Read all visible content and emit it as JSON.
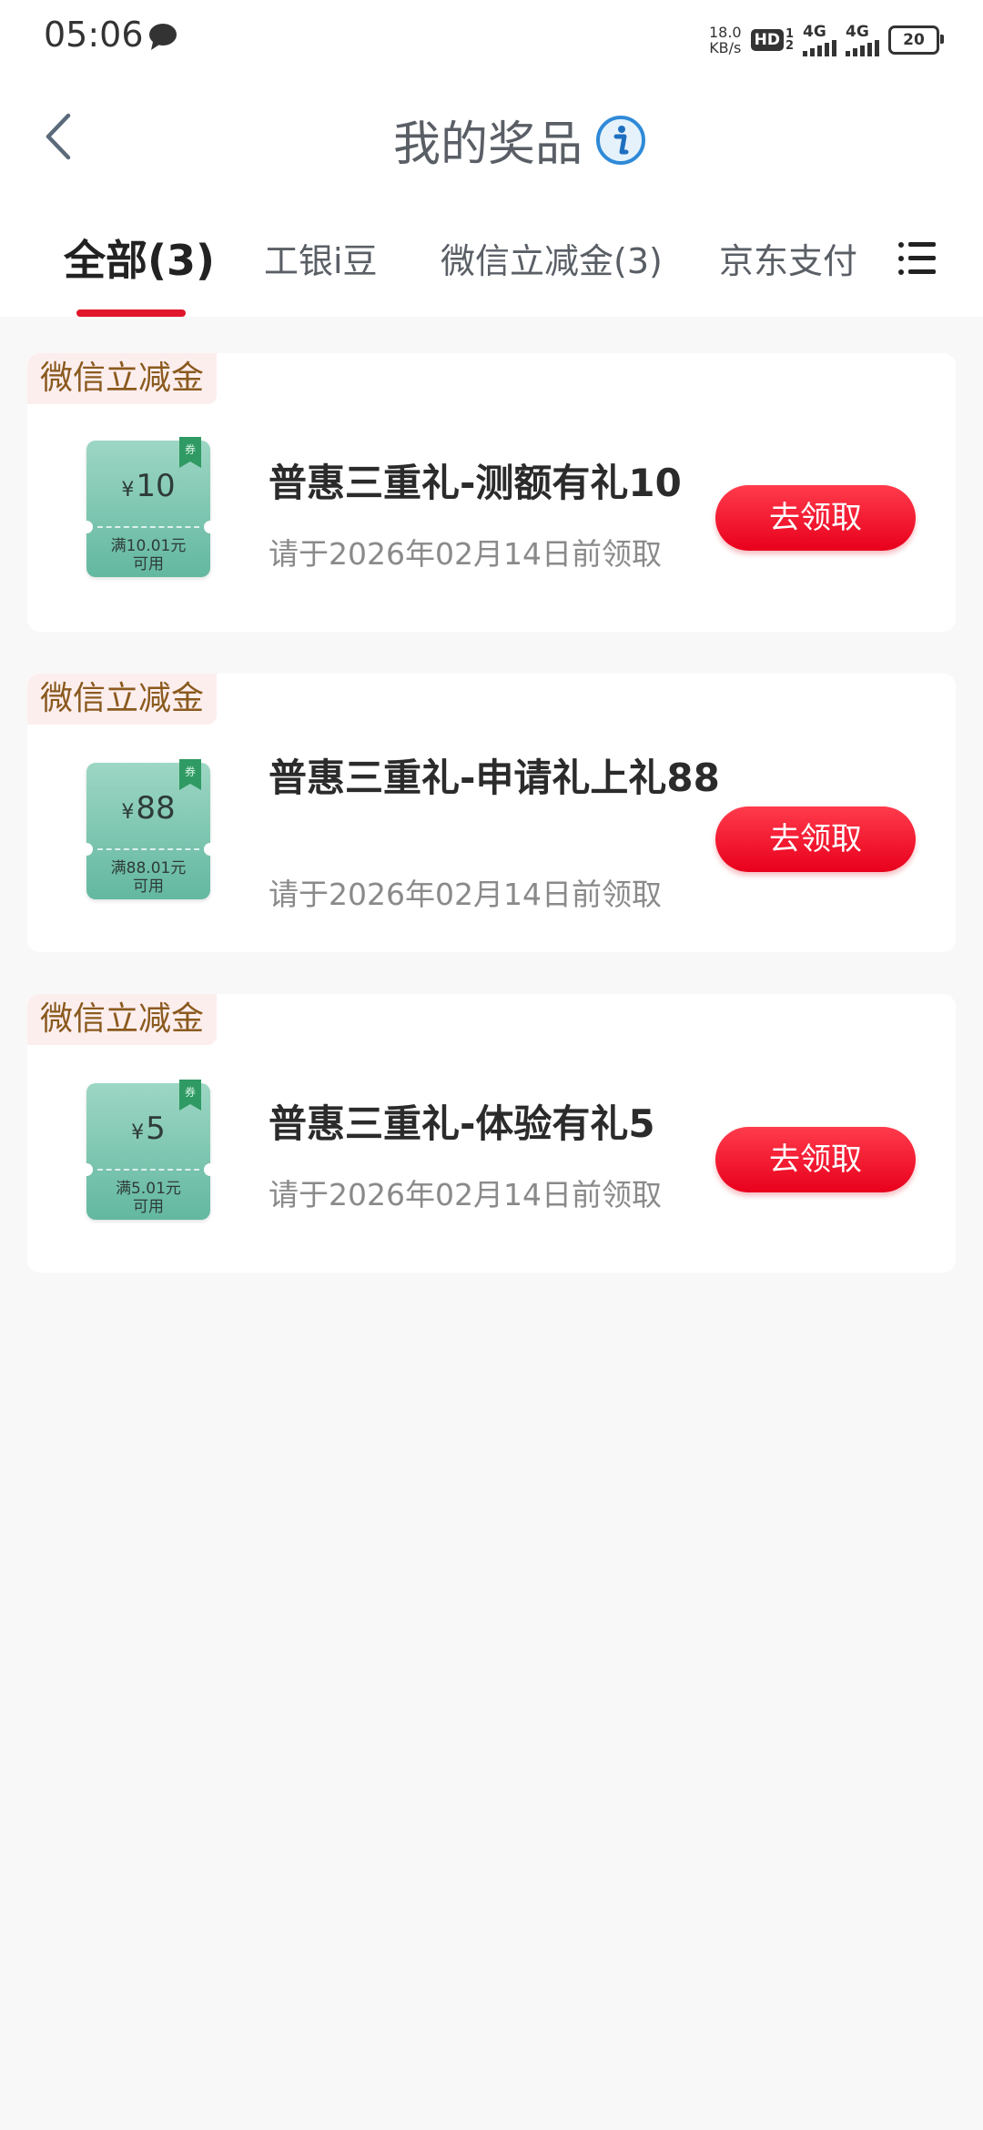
{
  "status_bar": {
    "time": "05:06",
    "net_speed_value": "18.0",
    "net_speed_unit": "KB/s",
    "hd_label": "HD",
    "hd_sub_1": "1",
    "hd_sub_2": "2",
    "signal1_label": "4G",
    "signal2_label": "4G",
    "battery_level": "20"
  },
  "header": {
    "title": "我的奖品"
  },
  "tabs": [
    {
      "label": "全部(3)",
      "active": true
    },
    {
      "label": "工银i豆",
      "active": false
    },
    {
      "label": "微信立减金(3)",
      "active": false
    },
    {
      "label": "京东支付",
      "active": false
    }
  ],
  "colors": {
    "accent": "#e1172c",
    "button": "#e8001c",
    "coupon": "#63b8a0",
    "tag_bg": "#fdeeee",
    "tag_text": "#8a5a1e"
  },
  "prizes": [
    {
      "tag": "微信立减金",
      "coupon_symbol": "¥",
      "coupon_amount": "10",
      "coupon_condition_1": "满10.01元",
      "coupon_condition_2": "可用",
      "name": "普惠三重礼-测额有礼10",
      "deadline": "请于2026年02月14日前领取",
      "button_label": "去领取"
    },
    {
      "tag": "微信立减金",
      "coupon_symbol": "¥",
      "coupon_amount": "88",
      "coupon_condition_1": "满88.01元",
      "coupon_condition_2": "可用",
      "name": "普惠三重礼-申请礼上礼88",
      "deadline": "请于2026年02月14日前领取",
      "button_label": "去领取"
    },
    {
      "tag": "微信立减金",
      "coupon_symbol": "¥",
      "coupon_amount": "5",
      "coupon_condition_1": "满5.01元",
      "coupon_condition_2": "可用",
      "name": "普惠三重礼-体验有礼5",
      "deadline": "请于2026年02月14日前领取",
      "button_label": "去领取"
    }
  ]
}
